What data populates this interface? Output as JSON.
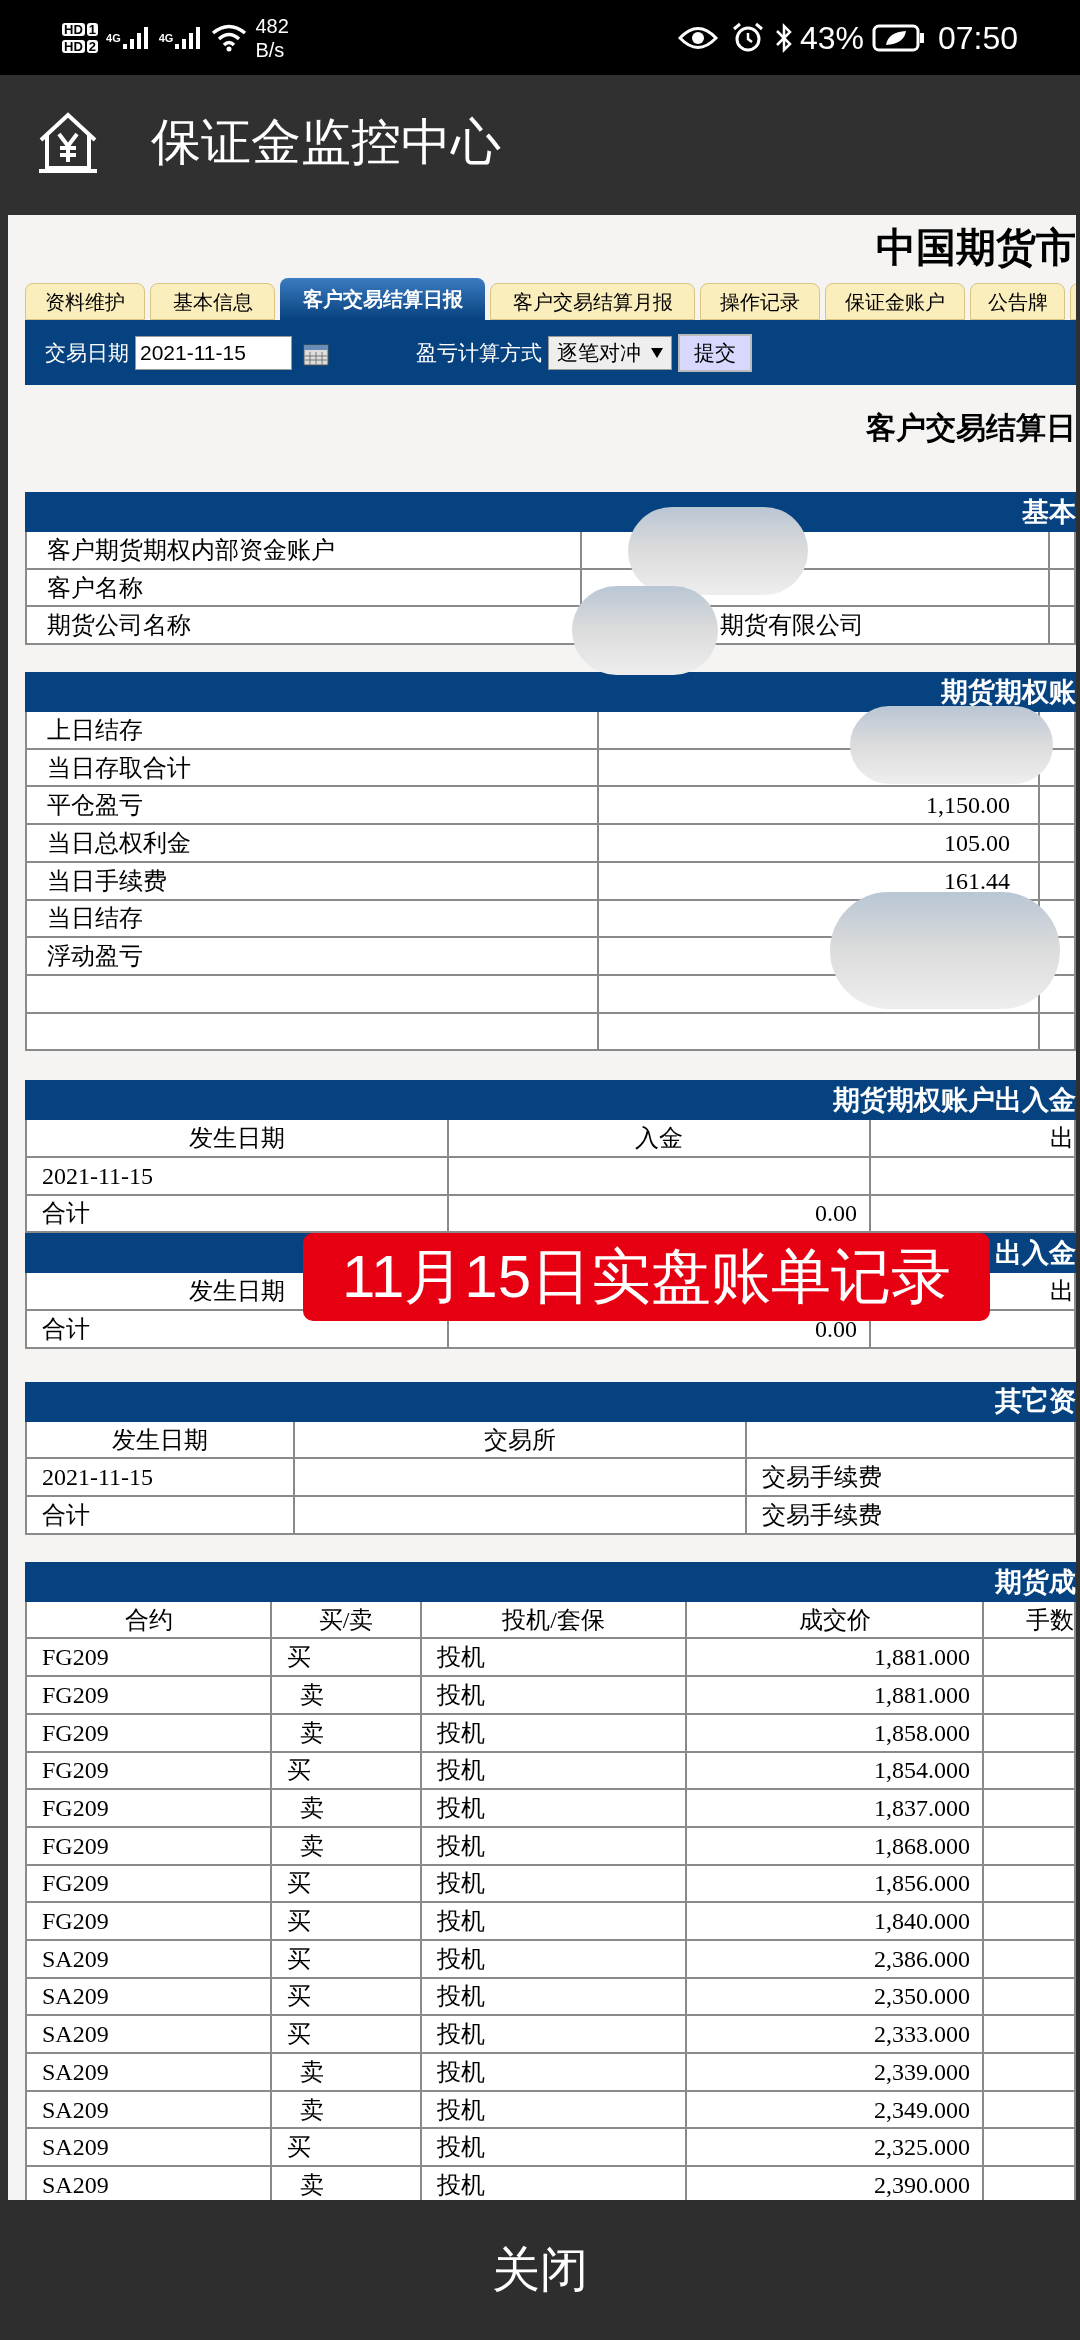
{
  "status_bar": {
    "sims": [
      {
        "label": "HD",
        "slot": "1"
      },
      {
        "label": "HD",
        "slot": "2"
      }
    ],
    "signals": [
      {
        "network": "4G"
      },
      {
        "network": "4G"
      }
    ],
    "speed": "482",
    "speed_unit": "B/s",
    "battery": "43%",
    "time": "07:50"
  },
  "app_bar": {
    "title": "保证金监控中心"
  },
  "page": {
    "site_title": "中国期货市",
    "tabs": [
      {
        "label": "资料维护",
        "selected": false
      },
      {
        "label": "基本信息",
        "selected": false
      },
      {
        "label": "客户交易结算日报",
        "selected": true
      },
      {
        "label": "客户交易结算月报",
        "selected": false
      },
      {
        "label": "操作记录",
        "selected": false
      },
      {
        "label": "保证金账户",
        "selected": false
      },
      {
        "label": "公告牌",
        "selected": false
      }
    ],
    "filter": {
      "date_label": "交易日期",
      "date_value": "2021-11-15",
      "method_label": "盈亏计算方式",
      "method_value": "逐笔对冲",
      "submit": "提交"
    },
    "report_title": "客户交易结算日"
  },
  "basic_info": {
    "title": "基本",
    "rows": [
      {
        "label": "客户期货期权内部资金账户"
      },
      {
        "label": "客户名称"
      },
      {
        "label": "期货公司名称",
        "value": "期货有限公司"
      }
    ]
  },
  "account": {
    "title": "期货期权账",
    "rows": [
      {
        "label": "上日结存"
      },
      {
        "label": "当日存取合计"
      },
      {
        "label": "平仓盈亏",
        "value": "1,150.00"
      },
      {
        "label": "当日总权利金",
        "value": "105.00"
      },
      {
        "label": "当日手续费",
        "value": "161.44"
      },
      {
        "label": "当日结存"
      },
      {
        "label": "浮动盈亏"
      }
    ]
  },
  "cash_flow": {
    "title": "期货期权账户出入金",
    "column_1": "发生日期",
    "column_2": "入金",
    "column_3": "出",
    "rows": [
      {
        "date": "2021-11-15"
      },
      {
        "date": "合计",
        "amount": "0.00"
      }
    ]
  },
  "cash_flow_2": {
    "title": "出入金",
    "column_1": "发生日期",
    "column_3": "出",
    "rows": [
      {
        "date": "合计",
        "amount": "0.00"
      }
    ]
  },
  "other_funds": {
    "title": "其它资",
    "column_1": "发生日期",
    "column_2": "交易所",
    "rows": [
      {
        "date": "2021-11-15",
        "column_3": "交易手续费"
      },
      {
        "date": "合计",
        "column_3": "交易手续费"
      }
    ]
  },
  "trades": {
    "title": "期货成",
    "columns": [
      "合约",
      "买/卖",
      "投机/套保",
      "成交价",
      "手数"
    ],
    "rows": [
      {
        "contract": "FG209",
        "side": "买",
        "kind": "buy",
        "type": "投机",
        "price": "1,881.000"
      },
      {
        "contract": "FG209",
        "side": "卖",
        "kind": "sell",
        "type": "投机",
        "price": "1,881.000"
      },
      {
        "contract": "FG209",
        "side": "卖",
        "kind": "sell",
        "type": "投机",
        "price": "1,858.000"
      },
      {
        "contract": "FG209",
        "side": "买",
        "kind": "buy",
        "type": "投机",
        "price": "1,854.000"
      },
      {
        "contract": "FG209",
        "side": "卖",
        "kind": "sell",
        "type": "投机",
        "price": "1,837.000"
      },
      {
        "contract": "FG209",
        "side": "卖",
        "kind": "sell",
        "type": "投机",
        "price": "1,868.000"
      },
      {
        "contract": "FG209",
        "side": "买",
        "kind": "buy",
        "type": "投机",
        "price": "1,856.000"
      },
      {
        "contract": "FG209",
        "side": "买",
        "kind": "buy",
        "type": "投机",
        "price": "1,840.000"
      },
      {
        "contract": "SA209",
        "side": "买",
        "kind": "buy",
        "type": "投机",
        "price": "2,386.000"
      },
      {
        "contract": "SA209",
        "side": "买",
        "kind": "buy",
        "type": "投机",
        "price": "2,350.000"
      },
      {
        "contract": "SA209",
        "side": "买",
        "kind": "buy",
        "type": "投机",
        "price": "2,333.000"
      },
      {
        "contract": "SA209",
        "side": "卖",
        "kind": "sell",
        "type": "投机",
        "price": "2,339.000"
      },
      {
        "contract": "SA209",
        "side": "卖",
        "kind": "sell",
        "type": "投机",
        "price": "2,349.000"
      },
      {
        "contract": "SA209",
        "side": "买",
        "kind": "buy",
        "type": "投机",
        "price": "2,325.000"
      },
      {
        "contract": "SA209",
        "side": "卖",
        "kind": "sell",
        "type": "投机",
        "price": "2,390.000"
      }
    ]
  },
  "overlay_label": "11月15日实盘账单记录",
  "close_button": "关闭"
}
